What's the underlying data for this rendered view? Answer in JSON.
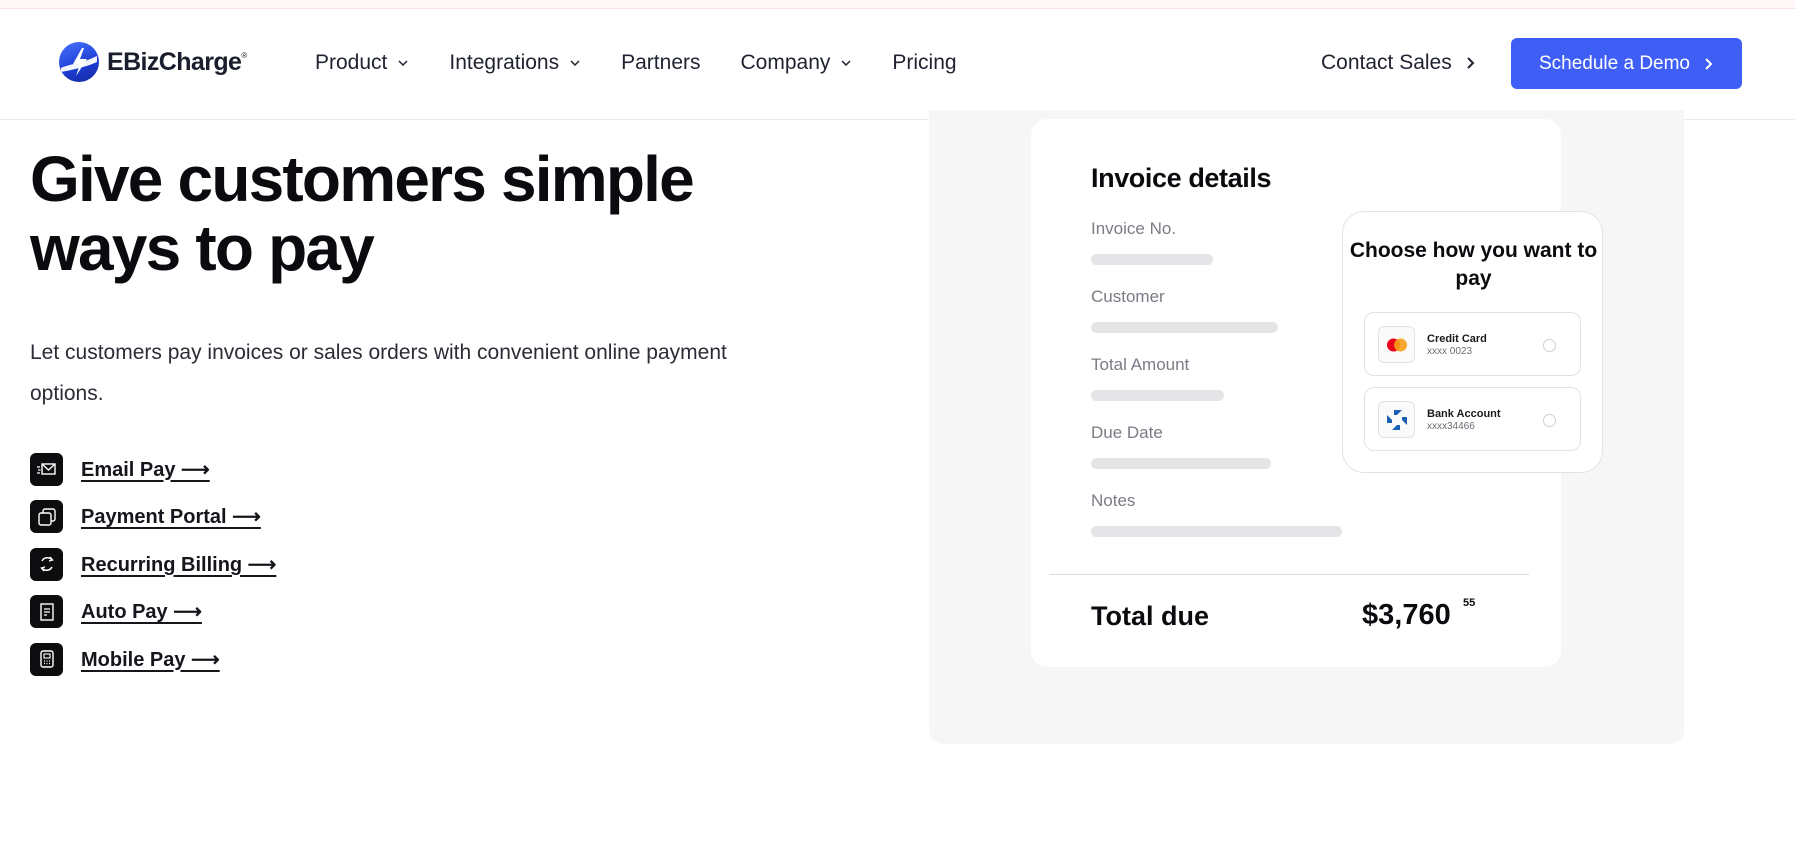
{
  "brand": {
    "name": "EBizCharge",
    "trademark": "®",
    "accent": "#3f5ef5"
  },
  "nav": {
    "items": [
      {
        "label": "Product",
        "dropdown": true
      },
      {
        "label": "Integrations",
        "dropdown": true
      },
      {
        "label": "Partners",
        "dropdown": false
      },
      {
        "label": "Company",
        "dropdown": true
      },
      {
        "label": "Pricing",
        "dropdown": false
      }
    ],
    "contact_label": "Contact Sales",
    "demo_label": "Schedule a Demo"
  },
  "hero": {
    "title": "Give customers simple ways to pay",
    "subtitle": "Let customers pay invoices or sales orders with convenient online payment options.",
    "links": [
      {
        "label": "Email Pay ⟶",
        "icon": "email-icon"
      },
      {
        "label": "Payment Portal ⟶",
        "icon": "portal-icon"
      },
      {
        "label": "Recurring Billing ⟶",
        "icon": "recurring-icon"
      },
      {
        "label": "Auto Pay ⟶",
        "icon": "receipt-icon"
      },
      {
        "label": "Mobile Pay ⟶",
        "icon": "mobile-icon"
      }
    ]
  },
  "invoice": {
    "title": "Invoice details",
    "fields": [
      {
        "label": "Invoice No."
      },
      {
        "label": "Customer"
      },
      {
        "label": "Total Amount"
      },
      {
        "label": "Due Date"
      },
      {
        "label": "Notes"
      }
    ],
    "total_label": "Total due",
    "total_amount": "$3,760",
    "total_cents": "55"
  },
  "payment": {
    "title": "Choose how you want to pay",
    "options": [
      {
        "name": "Credit Card",
        "number": "xxxx 0023",
        "icon": "mastercard-icon"
      },
      {
        "name": "Bank Account",
        "number": "xxxx34466",
        "icon": "bank-logo-icon"
      }
    ]
  }
}
